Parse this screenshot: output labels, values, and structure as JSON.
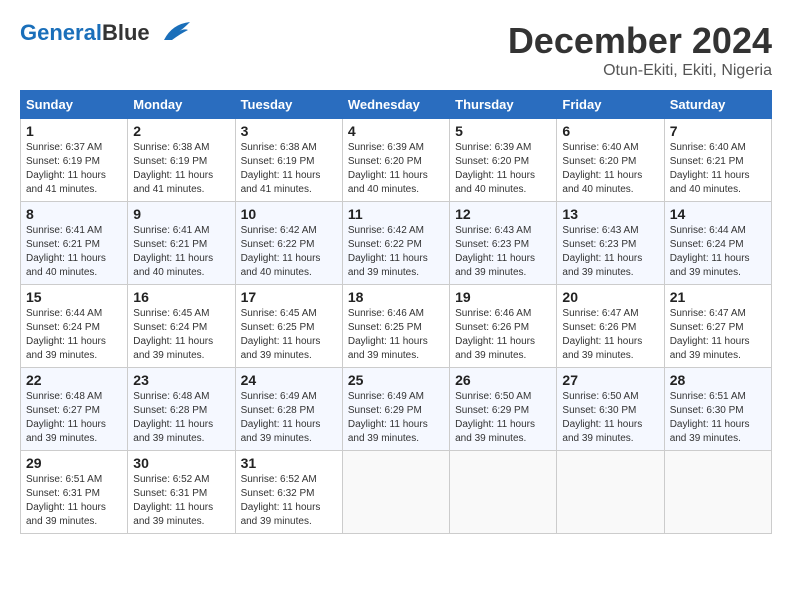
{
  "header": {
    "logo_general": "General",
    "logo_blue": "Blue",
    "month": "December 2024",
    "location": "Otun-Ekiti, Ekiti, Nigeria"
  },
  "columns": [
    "Sunday",
    "Monday",
    "Tuesday",
    "Wednesday",
    "Thursday",
    "Friday",
    "Saturday"
  ],
  "weeks": [
    [
      {
        "day": "1",
        "sunrise": "6:37 AM",
        "sunset": "6:19 PM",
        "daylight": "11 hours and 41 minutes."
      },
      {
        "day": "2",
        "sunrise": "6:38 AM",
        "sunset": "6:19 PM",
        "daylight": "11 hours and 41 minutes."
      },
      {
        "day": "3",
        "sunrise": "6:38 AM",
        "sunset": "6:19 PM",
        "daylight": "11 hours and 41 minutes."
      },
      {
        "day": "4",
        "sunrise": "6:39 AM",
        "sunset": "6:20 PM",
        "daylight": "11 hours and 40 minutes."
      },
      {
        "day": "5",
        "sunrise": "6:39 AM",
        "sunset": "6:20 PM",
        "daylight": "11 hours and 40 minutes."
      },
      {
        "day": "6",
        "sunrise": "6:40 AM",
        "sunset": "6:20 PM",
        "daylight": "11 hours and 40 minutes."
      },
      {
        "day": "7",
        "sunrise": "6:40 AM",
        "sunset": "6:21 PM",
        "daylight": "11 hours and 40 minutes."
      }
    ],
    [
      {
        "day": "8",
        "sunrise": "6:41 AM",
        "sunset": "6:21 PM",
        "daylight": "11 hours and 40 minutes."
      },
      {
        "day": "9",
        "sunrise": "6:41 AM",
        "sunset": "6:21 PM",
        "daylight": "11 hours and 40 minutes."
      },
      {
        "day": "10",
        "sunrise": "6:42 AM",
        "sunset": "6:22 PM",
        "daylight": "11 hours and 40 minutes."
      },
      {
        "day": "11",
        "sunrise": "6:42 AM",
        "sunset": "6:22 PM",
        "daylight": "11 hours and 39 minutes."
      },
      {
        "day": "12",
        "sunrise": "6:43 AM",
        "sunset": "6:23 PM",
        "daylight": "11 hours and 39 minutes."
      },
      {
        "day": "13",
        "sunrise": "6:43 AM",
        "sunset": "6:23 PM",
        "daylight": "11 hours and 39 minutes."
      },
      {
        "day": "14",
        "sunrise": "6:44 AM",
        "sunset": "6:24 PM",
        "daylight": "11 hours and 39 minutes."
      }
    ],
    [
      {
        "day": "15",
        "sunrise": "6:44 AM",
        "sunset": "6:24 PM",
        "daylight": "11 hours and 39 minutes."
      },
      {
        "day": "16",
        "sunrise": "6:45 AM",
        "sunset": "6:24 PM",
        "daylight": "11 hours and 39 minutes."
      },
      {
        "day": "17",
        "sunrise": "6:45 AM",
        "sunset": "6:25 PM",
        "daylight": "11 hours and 39 minutes."
      },
      {
        "day": "18",
        "sunrise": "6:46 AM",
        "sunset": "6:25 PM",
        "daylight": "11 hours and 39 minutes."
      },
      {
        "day": "19",
        "sunrise": "6:46 AM",
        "sunset": "6:26 PM",
        "daylight": "11 hours and 39 minutes."
      },
      {
        "day": "20",
        "sunrise": "6:47 AM",
        "sunset": "6:26 PM",
        "daylight": "11 hours and 39 minutes."
      },
      {
        "day": "21",
        "sunrise": "6:47 AM",
        "sunset": "6:27 PM",
        "daylight": "11 hours and 39 minutes."
      }
    ],
    [
      {
        "day": "22",
        "sunrise": "6:48 AM",
        "sunset": "6:27 PM",
        "daylight": "11 hours and 39 minutes."
      },
      {
        "day": "23",
        "sunrise": "6:48 AM",
        "sunset": "6:28 PM",
        "daylight": "11 hours and 39 minutes."
      },
      {
        "day": "24",
        "sunrise": "6:49 AM",
        "sunset": "6:28 PM",
        "daylight": "11 hours and 39 minutes."
      },
      {
        "day": "25",
        "sunrise": "6:49 AM",
        "sunset": "6:29 PM",
        "daylight": "11 hours and 39 minutes."
      },
      {
        "day": "26",
        "sunrise": "6:50 AM",
        "sunset": "6:29 PM",
        "daylight": "11 hours and 39 minutes."
      },
      {
        "day": "27",
        "sunrise": "6:50 AM",
        "sunset": "6:30 PM",
        "daylight": "11 hours and 39 minutes."
      },
      {
        "day": "28",
        "sunrise": "6:51 AM",
        "sunset": "6:30 PM",
        "daylight": "11 hours and 39 minutes."
      }
    ],
    [
      {
        "day": "29",
        "sunrise": "6:51 AM",
        "sunset": "6:31 PM",
        "daylight": "11 hours and 39 minutes."
      },
      {
        "day": "30",
        "sunrise": "6:52 AM",
        "sunset": "6:31 PM",
        "daylight": "11 hours and 39 minutes."
      },
      {
        "day": "31",
        "sunrise": "6:52 AM",
        "sunset": "6:32 PM",
        "daylight": "11 hours and 39 minutes."
      },
      null,
      null,
      null,
      null
    ]
  ]
}
